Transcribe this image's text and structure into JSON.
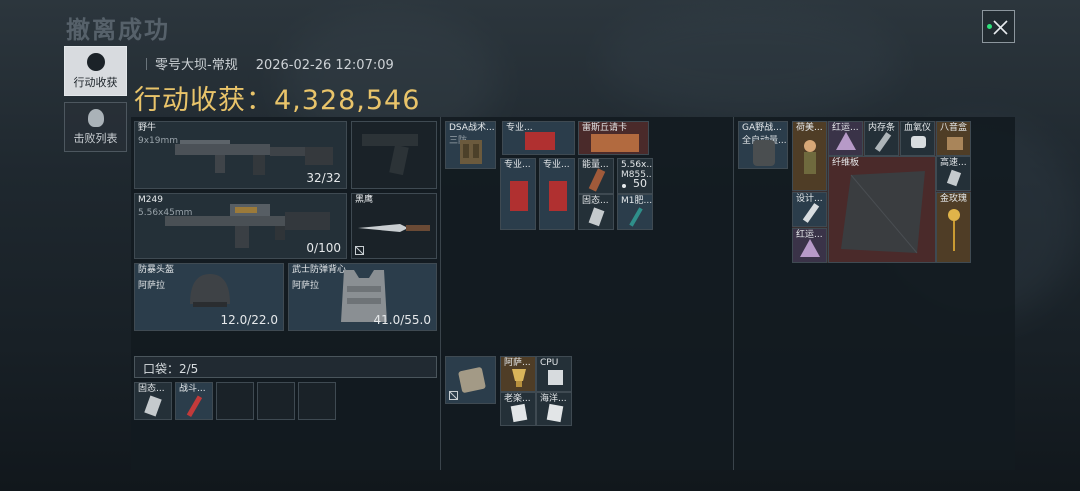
{
  "title": "撤离成功",
  "sidebar": {
    "tabs": [
      {
        "label": "行动收获",
        "active": true,
        "icon": "loot-icon"
      },
      {
        "label": "击败列表",
        "active": false,
        "icon": "skull-icon"
      }
    ]
  },
  "match": {
    "map": "零号大坝-常规",
    "datetime": "2026-02-26 12:07:09"
  },
  "loot_value": "行动收获：4,328,546",
  "equipment": {
    "primary": {
      "name": "野牛",
      "caliber": "9x19mm",
      "ammo": "32/32"
    },
    "secondary": {
      "name": "M249",
      "caliber": "5.56x45mm",
      "ammo": "0/100"
    },
    "pistol": {
      "name": ""
    },
    "melee": {
      "name": "黑鹰"
    },
    "helmet": {
      "name": "防暴头盔",
      "origin": "阿萨拉",
      "durability": "12.0/22.0"
    },
    "armor": {
      "name": "武士防弹背心",
      "origin": "阿萨拉",
      "durability": "41.0/55.0"
    }
  },
  "pocket": {
    "label": "口袋：2/5",
    "items": [
      "固态...",
      "战斗..."
    ]
  },
  "chest_rig": {
    "name": "DSA战术...",
    "sub": "三防...",
    "items": [
      {
        "label": "专业..."
      },
      {
        "label": "雷斯丘请卡"
      },
      {
        "label": "专业..."
      },
      {
        "label": "专业..."
      },
      {
        "label": "能量..."
      },
      {
        "label": "5.56x...",
        "sub": "M855...",
        "count": "50"
      },
      {
        "label": "固态..."
      },
      {
        "label": "M1肥..."
      }
    ]
  },
  "pouch": {
    "items": [
      {
        "label": "阿萨..."
      },
      {
        "label": "CPU"
      },
      {
        "label": "老楽..."
      },
      {
        "label": "海洋..."
      }
    ]
  },
  "backpack": {
    "name": "GA野战...",
    "sub": "全自动量...",
    "items": [
      {
        "label": "荷美..."
      },
      {
        "label": "红运..."
      },
      {
        "label": "内存条"
      },
      {
        "label": "血氧仪"
      },
      {
        "label": "八音盒"
      },
      {
        "label": "纤维板"
      },
      {
        "label": "高速..."
      },
      {
        "label": "设计..."
      },
      {
        "label": "金玫瑰"
      },
      {
        "label": "红运..."
      }
    ]
  },
  "colors": {
    "accent_gold": "#e9c46a",
    "success_green": "#2de07a"
  }
}
